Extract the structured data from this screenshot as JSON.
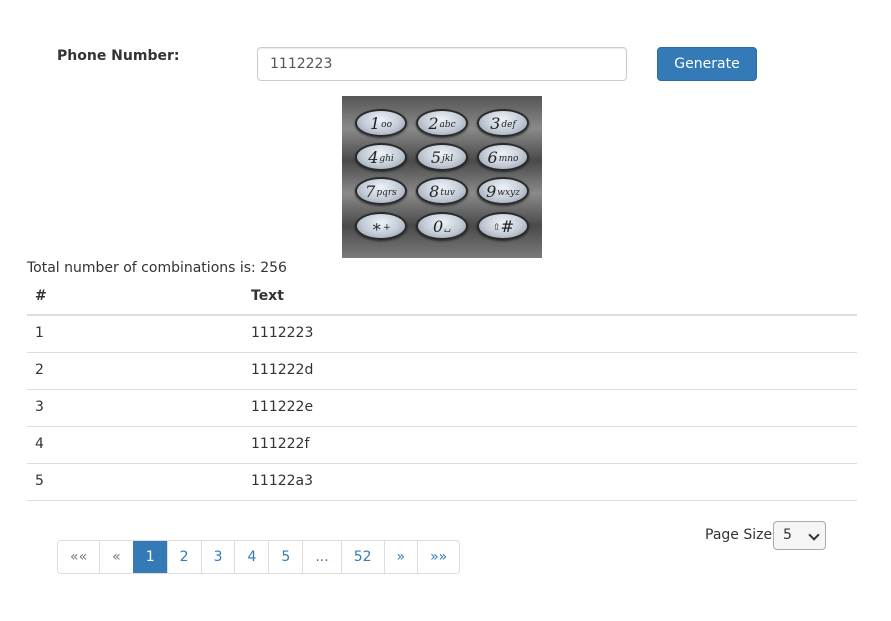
{
  "form": {
    "phone_label": "Phone Number:",
    "phone_value": "1112223",
    "generate_label": "Generate"
  },
  "keypad": {
    "keys": [
      {
        "num": "1",
        "letters": "‘‘"
      },
      {
        "num": "2",
        "letters": "abc"
      },
      {
        "num": "3",
        "letters": "def"
      },
      {
        "num": "4",
        "letters": "ghi"
      },
      {
        "num": "5",
        "letters": "jkl"
      },
      {
        "num": "6",
        "letters": "mno"
      },
      {
        "num": "7",
        "letters": "pqrs"
      },
      {
        "num": "8",
        "letters": "tuv"
      },
      {
        "num": "9",
        "letters": "wxyz"
      },
      {
        "num": "∗",
        "letters": "+"
      },
      {
        "num": "0",
        "letters": "␣"
      },
      {
        "num": "#",
        "letters": "⇧"
      }
    ]
  },
  "results": {
    "total_text": "Total number of combinations is: 256",
    "columns": [
      "#",
      "Text"
    ],
    "rows": [
      {
        "index": "1",
        "text": "1112223"
      },
      {
        "index": "2",
        "text": "111222d"
      },
      {
        "index": "3",
        "text": "111222e"
      },
      {
        "index": "4",
        "text": "111222f"
      },
      {
        "index": "5",
        "text": "11122a3"
      }
    ]
  },
  "pagination": {
    "first": "««",
    "prev": "«",
    "pages": [
      "1",
      "2",
      "3",
      "4",
      "5"
    ],
    "ellipsis": "...",
    "last_page": "52",
    "next": "»",
    "last": "»»",
    "active_page": "1"
  },
  "page_size": {
    "label": "Page Size",
    "value": "5"
  },
  "colors": {
    "primary": "#337ab7",
    "border": "#dddddd"
  }
}
